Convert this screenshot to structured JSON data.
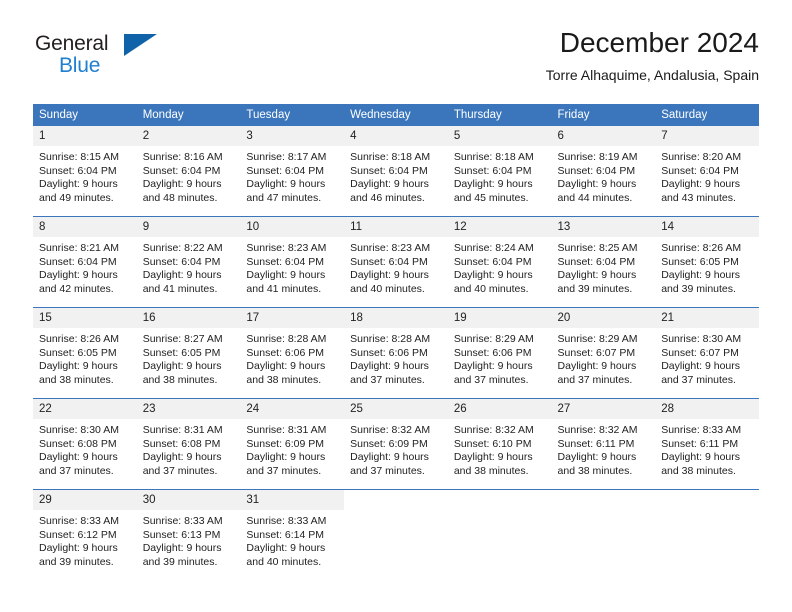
{
  "brand": {
    "name_part1": "General",
    "name_part2": "Blue",
    "triangle_color": "#1063a8",
    "blue_color": "#1f7fd0"
  },
  "header": {
    "title": "December 2024",
    "subtitle": "Torre Alhaquime, Andalusia, Spain"
  },
  "theme": {
    "header_blue": "#3b76bc",
    "daynum_gray": "#f1f1f1"
  },
  "weekdays": [
    "Sunday",
    "Monday",
    "Tuesday",
    "Wednesday",
    "Thursday",
    "Friday",
    "Saturday"
  ],
  "weeks": [
    [
      {
        "day": "1",
        "sunrise": "Sunrise: 8:15 AM",
        "sunset": "Sunset: 6:04 PM",
        "daylight1": "Daylight: 9 hours",
        "daylight2": "and 49 minutes."
      },
      {
        "day": "2",
        "sunrise": "Sunrise: 8:16 AM",
        "sunset": "Sunset: 6:04 PM",
        "daylight1": "Daylight: 9 hours",
        "daylight2": "and 48 minutes."
      },
      {
        "day": "3",
        "sunrise": "Sunrise: 8:17 AM",
        "sunset": "Sunset: 6:04 PM",
        "daylight1": "Daylight: 9 hours",
        "daylight2": "and 47 minutes."
      },
      {
        "day": "4",
        "sunrise": "Sunrise: 8:18 AM",
        "sunset": "Sunset: 6:04 PM",
        "daylight1": "Daylight: 9 hours",
        "daylight2": "and 46 minutes."
      },
      {
        "day": "5",
        "sunrise": "Sunrise: 8:18 AM",
        "sunset": "Sunset: 6:04 PM",
        "daylight1": "Daylight: 9 hours",
        "daylight2": "and 45 minutes."
      },
      {
        "day": "6",
        "sunrise": "Sunrise: 8:19 AM",
        "sunset": "Sunset: 6:04 PM",
        "daylight1": "Daylight: 9 hours",
        "daylight2": "and 44 minutes."
      },
      {
        "day": "7",
        "sunrise": "Sunrise: 8:20 AM",
        "sunset": "Sunset: 6:04 PM",
        "daylight1": "Daylight: 9 hours",
        "daylight2": "and 43 minutes."
      }
    ],
    [
      {
        "day": "8",
        "sunrise": "Sunrise: 8:21 AM",
        "sunset": "Sunset: 6:04 PM",
        "daylight1": "Daylight: 9 hours",
        "daylight2": "and 42 minutes."
      },
      {
        "day": "9",
        "sunrise": "Sunrise: 8:22 AM",
        "sunset": "Sunset: 6:04 PM",
        "daylight1": "Daylight: 9 hours",
        "daylight2": "and 41 minutes."
      },
      {
        "day": "10",
        "sunrise": "Sunrise: 8:23 AM",
        "sunset": "Sunset: 6:04 PM",
        "daylight1": "Daylight: 9 hours",
        "daylight2": "and 41 minutes."
      },
      {
        "day": "11",
        "sunrise": "Sunrise: 8:23 AM",
        "sunset": "Sunset: 6:04 PM",
        "daylight1": "Daylight: 9 hours",
        "daylight2": "and 40 minutes."
      },
      {
        "day": "12",
        "sunrise": "Sunrise: 8:24 AM",
        "sunset": "Sunset: 6:04 PM",
        "daylight1": "Daylight: 9 hours",
        "daylight2": "and 40 minutes."
      },
      {
        "day": "13",
        "sunrise": "Sunrise: 8:25 AM",
        "sunset": "Sunset: 6:04 PM",
        "daylight1": "Daylight: 9 hours",
        "daylight2": "and 39 minutes."
      },
      {
        "day": "14",
        "sunrise": "Sunrise: 8:26 AM",
        "sunset": "Sunset: 6:05 PM",
        "daylight1": "Daylight: 9 hours",
        "daylight2": "and 39 minutes."
      }
    ],
    [
      {
        "day": "15",
        "sunrise": "Sunrise: 8:26 AM",
        "sunset": "Sunset: 6:05 PM",
        "daylight1": "Daylight: 9 hours",
        "daylight2": "and 38 minutes."
      },
      {
        "day": "16",
        "sunrise": "Sunrise: 8:27 AM",
        "sunset": "Sunset: 6:05 PM",
        "daylight1": "Daylight: 9 hours",
        "daylight2": "and 38 minutes."
      },
      {
        "day": "17",
        "sunrise": "Sunrise: 8:28 AM",
        "sunset": "Sunset: 6:06 PM",
        "daylight1": "Daylight: 9 hours",
        "daylight2": "and 38 minutes."
      },
      {
        "day": "18",
        "sunrise": "Sunrise: 8:28 AM",
        "sunset": "Sunset: 6:06 PM",
        "daylight1": "Daylight: 9 hours",
        "daylight2": "and 37 minutes."
      },
      {
        "day": "19",
        "sunrise": "Sunrise: 8:29 AM",
        "sunset": "Sunset: 6:06 PM",
        "daylight1": "Daylight: 9 hours",
        "daylight2": "and 37 minutes."
      },
      {
        "day": "20",
        "sunrise": "Sunrise: 8:29 AM",
        "sunset": "Sunset: 6:07 PM",
        "daylight1": "Daylight: 9 hours",
        "daylight2": "and 37 minutes."
      },
      {
        "day": "21",
        "sunrise": "Sunrise: 8:30 AM",
        "sunset": "Sunset: 6:07 PM",
        "daylight1": "Daylight: 9 hours",
        "daylight2": "and 37 minutes."
      }
    ],
    [
      {
        "day": "22",
        "sunrise": "Sunrise: 8:30 AM",
        "sunset": "Sunset: 6:08 PM",
        "daylight1": "Daylight: 9 hours",
        "daylight2": "and 37 minutes."
      },
      {
        "day": "23",
        "sunrise": "Sunrise: 8:31 AM",
        "sunset": "Sunset: 6:08 PM",
        "daylight1": "Daylight: 9 hours",
        "daylight2": "and 37 minutes."
      },
      {
        "day": "24",
        "sunrise": "Sunrise: 8:31 AM",
        "sunset": "Sunset: 6:09 PM",
        "daylight1": "Daylight: 9 hours",
        "daylight2": "and 37 minutes."
      },
      {
        "day": "25",
        "sunrise": "Sunrise: 8:32 AM",
        "sunset": "Sunset: 6:09 PM",
        "daylight1": "Daylight: 9 hours",
        "daylight2": "and 37 minutes."
      },
      {
        "day": "26",
        "sunrise": "Sunrise: 8:32 AM",
        "sunset": "Sunset: 6:10 PM",
        "daylight1": "Daylight: 9 hours",
        "daylight2": "and 38 minutes."
      },
      {
        "day": "27",
        "sunrise": "Sunrise: 8:32 AM",
        "sunset": "Sunset: 6:11 PM",
        "daylight1": "Daylight: 9 hours",
        "daylight2": "and 38 minutes."
      },
      {
        "day": "28",
        "sunrise": "Sunrise: 8:33 AM",
        "sunset": "Sunset: 6:11 PM",
        "daylight1": "Daylight: 9 hours",
        "daylight2": "and 38 minutes."
      }
    ],
    [
      {
        "day": "29",
        "sunrise": "Sunrise: 8:33 AM",
        "sunset": "Sunset: 6:12 PM",
        "daylight1": "Daylight: 9 hours",
        "daylight2": "and 39 minutes."
      },
      {
        "day": "30",
        "sunrise": "Sunrise: 8:33 AM",
        "sunset": "Sunset: 6:13 PM",
        "daylight1": "Daylight: 9 hours",
        "daylight2": "and 39 minutes."
      },
      {
        "day": "31",
        "sunrise": "Sunrise: 8:33 AM",
        "sunset": "Sunset: 6:14 PM",
        "daylight1": "Daylight: 9 hours",
        "daylight2": "and 40 minutes."
      },
      {
        "day": "",
        "sunrise": "",
        "sunset": "",
        "daylight1": "",
        "daylight2": ""
      },
      {
        "day": "",
        "sunrise": "",
        "sunset": "",
        "daylight1": "",
        "daylight2": ""
      },
      {
        "day": "",
        "sunrise": "",
        "sunset": "",
        "daylight1": "",
        "daylight2": ""
      },
      {
        "day": "",
        "sunrise": "",
        "sunset": "",
        "daylight1": "",
        "daylight2": ""
      }
    ]
  ]
}
